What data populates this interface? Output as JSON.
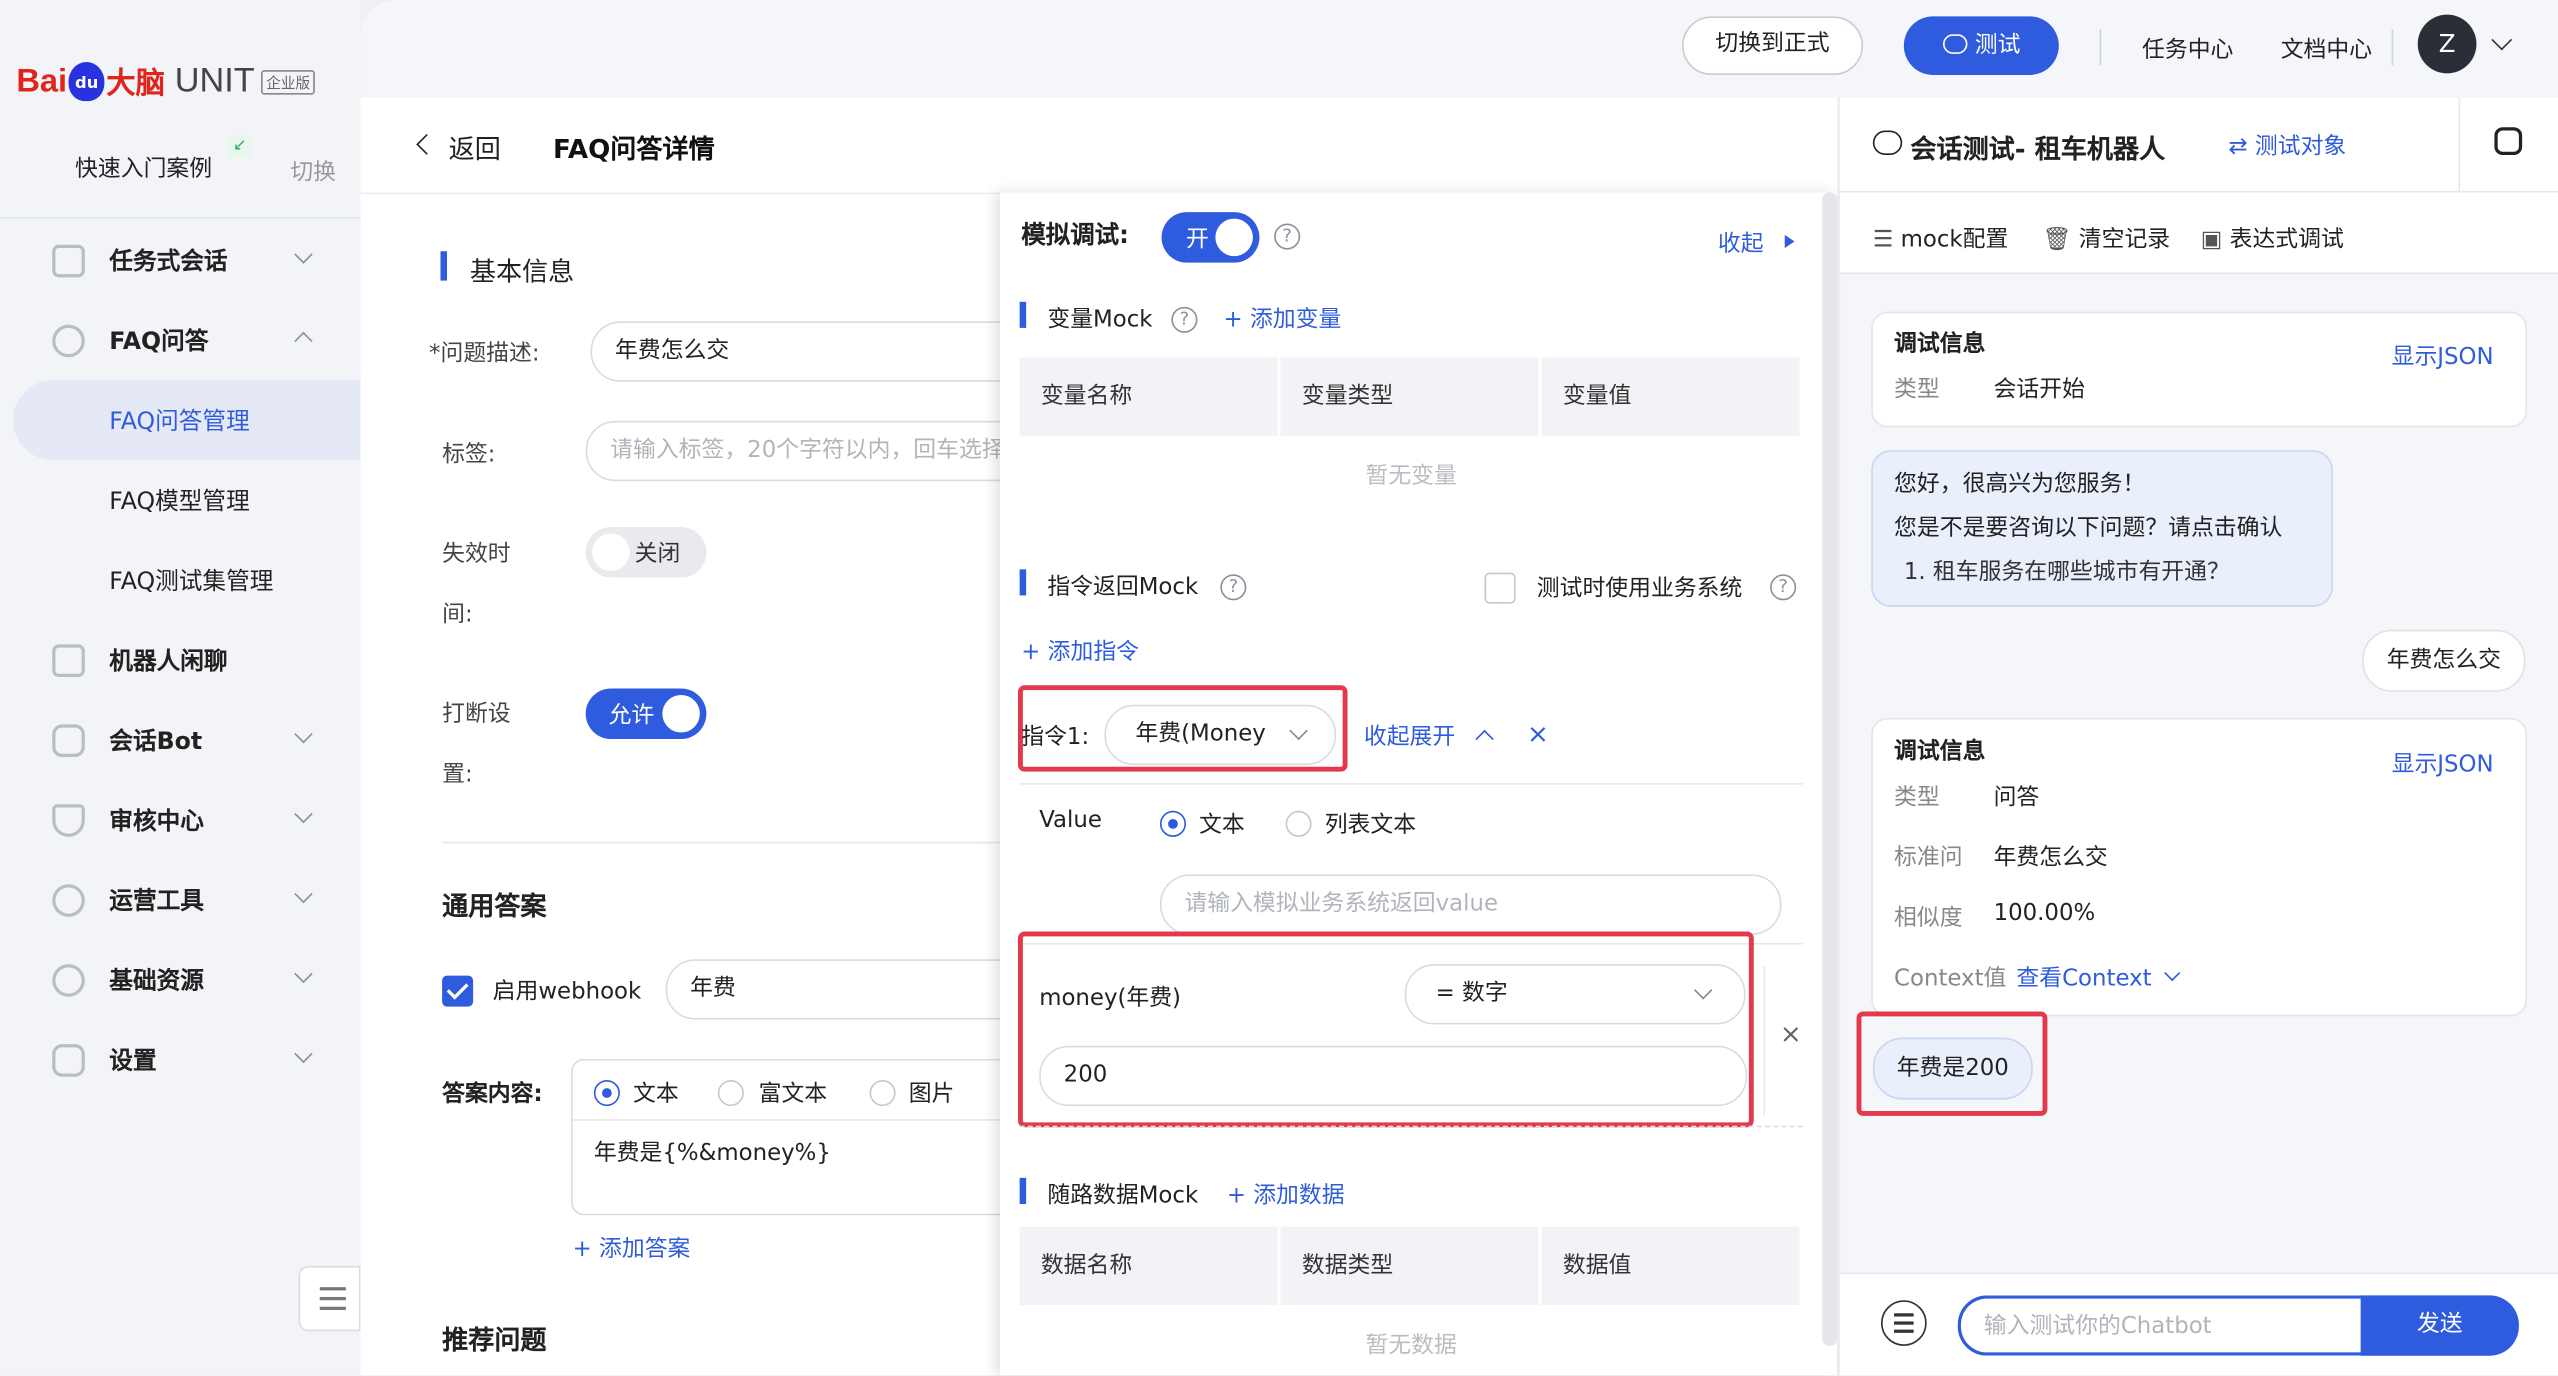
{
  "logo": {
    "bai": "Bai",
    "du": "du",
    "brain": "大脑",
    "unit": "UNIT",
    "edition": "企业版"
  },
  "sidebar": {
    "quick_start": "快速入门案例",
    "switch": "切换",
    "items": [
      {
        "label": "任务式会话"
      },
      {
        "label": "FAQ问答"
      },
      {
        "label": "FAQ问答管理"
      },
      {
        "label": "FAQ模型管理"
      },
      {
        "label": "FAQ测试集管理"
      },
      {
        "label": "机器人闲聊"
      },
      {
        "label": "会话Bot"
      },
      {
        "label": "审核中心"
      },
      {
        "label": "运营工具"
      },
      {
        "label": "基础资源"
      },
      {
        "label": "设置"
      }
    ]
  },
  "topbar": {
    "switch_formal": "切换到正式",
    "test": "测试",
    "task_center": "任务中心",
    "doc_center": "文档中心",
    "avatar": "Z"
  },
  "detail": {
    "back": "返回",
    "title": "FAQ问答详情",
    "basic_info": "基本信息",
    "question_label": "*问题描述:",
    "question_value": "年费怎么交",
    "tag_label": "标签:",
    "tag_placeholder": "请输入标签，20个字符以内，回车选择",
    "expire_label_1": "失效时",
    "expire_label_2": "间:",
    "expire_toggle": "关闭",
    "interrupt_label_1": "打断设",
    "interrupt_label_2": "置:",
    "interrupt_toggle": "允许",
    "general_answer": "通用答案",
    "webhook_label": "启用webhook",
    "webhook_value": "年费",
    "answer_content_label": "答案内容:",
    "answer_types": [
      "文本",
      "富文本",
      "图片"
    ],
    "answer_text": "年费是{%&money%}",
    "add_answer": "+ 添加答案",
    "recommend": "推荐问题"
  },
  "mock": {
    "title": "模拟调试:",
    "toggle": "开",
    "collapse": "收起",
    "var_mock": "变量Mock",
    "add_var": "+ 添加变量",
    "var_headers": [
      "变量名称",
      "变量类型",
      "变量值"
    ],
    "var_empty": "暂无变量",
    "cmd_mock": "指令返回Mock",
    "use_business": "测试时使用业务系统",
    "add_cmd": "+ 添加指令",
    "cmd_label": "指令1:",
    "cmd_select": "年费(Money",
    "collapse_expand": "收起展开",
    "value_label": "Value",
    "value_types": [
      "文本",
      "列表文本"
    ],
    "value_placeholder": "请输入模拟业务系统返回value",
    "slot_name": "money(年费)",
    "slot_type": "= 数字",
    "slot_value": "200",
    "random_mock": "随路数据Mock",
    "add_data": "+ 添加数据",
    "data_headers": [
      "数据名称",
      "数据类型",
      "数据值"
    ],
    "data_empty": "暂无数据"
  },
  "chat": {
    "title": "会话测试- 租车机器人",
    "test_target": "测试对象",
    "tools": [
      "mock配置",
      "清空记录",
      "表达式调试"
    ],
    "card1": {
      "title": "调试信息",
      "show_json": "显示JSON",
      "k1": "类型",
      "v1": "会话开始"
    },
    "bot_msg": {
      "line1": "您好，很高兴为您服务！",
      "line2": "您是不是要咨询以下问题？请点击确认",
      "line3": "1. 租车服务在哪些城市有开通？"
    },
    "user_msg": "年费怎么交",
    "card2": {
      "title": "调试信息",
      "show_json": "显示JSON",
      "k1": "类型",
      "v1": "问答",
      "k2": "标准问",
      "v2": "年费怎么交",
      "k3": "相似度",
      "v3": "100.00%",
      "k4": "Context值",
      "v4": "查看Context"
    },
    "bot_reply": "年费是200",
    "input_placeholder": "输入测试你的Chatbot",
    "send": "发送"
  },
  "colors": {
    "accent": "#2f5cde",
    "highlight_red": "#e23a4c",
    "brand_red": "#e1251b"
  }
}
